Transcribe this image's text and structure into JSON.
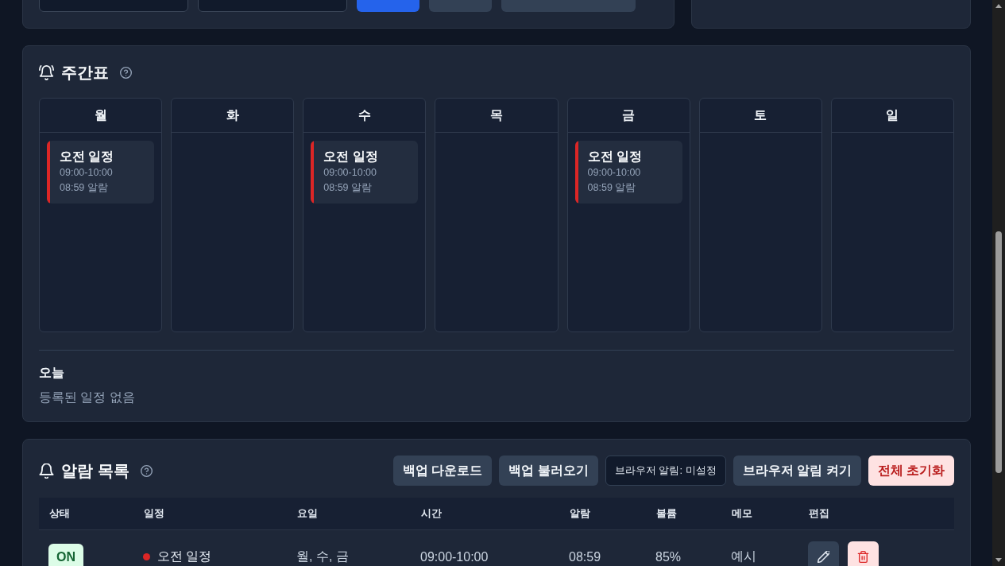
{
  "add_form": {
    "controls": [
      {
        "kind": "field"
      },
      {
        "kind": "field"
      },
      {
        "kind": "primary"
      },
      {
        "kind": "button"
      },
      {
        "kind": "button"
      }
    ]
  },
  "weekly": {
    "title": "주간표",
    "days": [
      {
        "label": "월",
        "events": [
          {
            "title": "오전 일정",
            "time": "09:00-10:00",
            "alarm": "08:59 알람",
            "color": "#dc2626"
          }
        ]
      },
      {
        "label": "화"
      },
      {
        "label": "수",
        "events": [
          {
            "title": "오전 일정",
            "time": "09:00-10:00",
            "alarm": "08:59 알람",
            "color": "#dc2626"
          }
        ]
      },
      {
        "label": "목"
      },
      {
        "label": "금",
        "events": [
          {
            "title": "오전 일정",
            "time": "09:00-10:00",
            "alarm": "08:59 알람",
            "color": "#dc2626"
          }
        ]
      },
      {
        "label": "토"
      },
      {
        "label": "일"
      }
    ],
    "today": {
      "label": "오늘",
      "empty_text": "등록된 일정 없음"
    }
  },
  "alarms": {
    "title": "알람 목록",
    "actions": [
      {
        "label": "백업 다운로드",
        "kind": "button"
      },
      {
        "label": "백업 불러오기",
        "kind": "button"
      },
      {
        "label": "브라우저 알림: 미설정",
        "kind": "status"
      },
      {
        "label": "브라우저 알림 켜기",
        "kind": "button"
      },
      {
        "label": "전체 초기화",
        "kind": "danger"
      }
    ],
    "table": {
      "columns": [
        "상태",
        "일정",
        "요일",
        "시간",
        "알람",
        "볼륨",
        "메모",
        "편집"
      ],
      "rows": [
        {
          "status": "ON",
          "on": true,
          "name": "오전 일정",
          "color": "#dc2626",
          "days": "월, 수, 금",
          "time": "09:00-10:00",
          "alarm": "08:59",
          "volume": "85%",
          "memo": "예시"
        }
      ]
    }
  }
}
